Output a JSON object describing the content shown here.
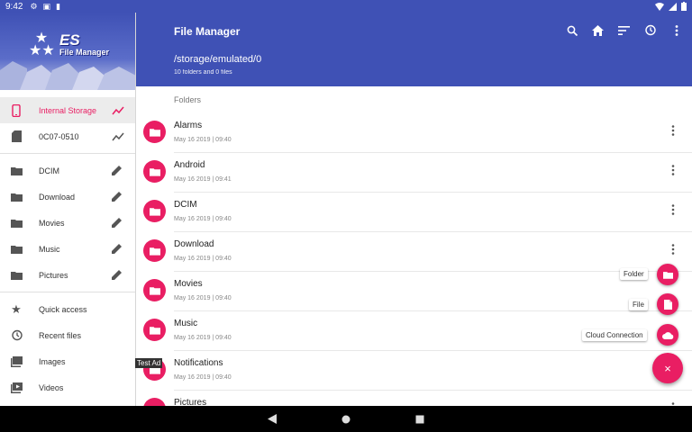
{
  "status_bar": {
    "time": "9:42"
  },
  "drawer": {
    "logo_es": "ES",
    "logo_fm": "File Manager",
    "storage": [
      {
        "label": "Internal Storage",
        "icon": "phone-icon",
        "active": true
      },
      {
        "label": "0C07-0510",
        "icon": "sd-card-icon",
        "active": false
      }
    ],
    "bookmarks": [
      {
        "label": "DCIM"
      },
      {
        "label": "Download"
      },
      {
        "label": "Movies"
      },
      {
        "label": "Music"
      },
      {
        "label": "Pictures"
      }
    ],
    "library": [
      {
        "label": "Quick access",
        "icon": "star-icon"
      },
      {
        "label": "Recent files",
        "icon": "history-icon"
      },
      {
        "label": "Images",
        "icon": "image-icon"
      },
      {
        "label": "Videos",
        "icon": "video-icon"
      }
    ]
  },
  "appbar": {
    "title": "File Manager",
    "path": "/storage/emulated/0",
    "summary": "10 folders and 0 files",
    "actions": [
      "search-icon",
      "home-icon",
      "sort-icon",
      "history-icon",
      "more-vert-icon"
    ]
  },
  "list": {
    "section_label": "Folders",
    "folders": [
      {
        "name": "Alarms",
        "date": "May 16 2019 | 09:40"
      },
      {
        "name": "Android",
        "date": "May 16 2019 | 09:41"
      },
      {
        "name": "DCIM",
        "date": "May 16 2019 | 09:40"
      },
      {
        "name": "Download",
        "date": "May 16 2019 | 09:40"
      },
      {
        "name": "Movies",
        "date": "May 16 2019 | 09:40"
      },
      {
        "name": "Music",
        "date": "May 16 2019 | 09:40"
      },
      {
        "name": "Notifications",
        "date": "May 16 2019 | 09:40"
      },
      {
        "name": "Pictures",
        "date": ""
      }
    ]
  },
  "fab_menu": {
    "folder_label": "Folder",
    "file_label": "File",
    "cloud_label": "Cloud Connection",
    "close_glyph": "×"
  },
  "test_ad": "Test Ad",
  "colors": {
    "primary": "#3f51b5",
    "accent": "#e91e63"
  }
}
